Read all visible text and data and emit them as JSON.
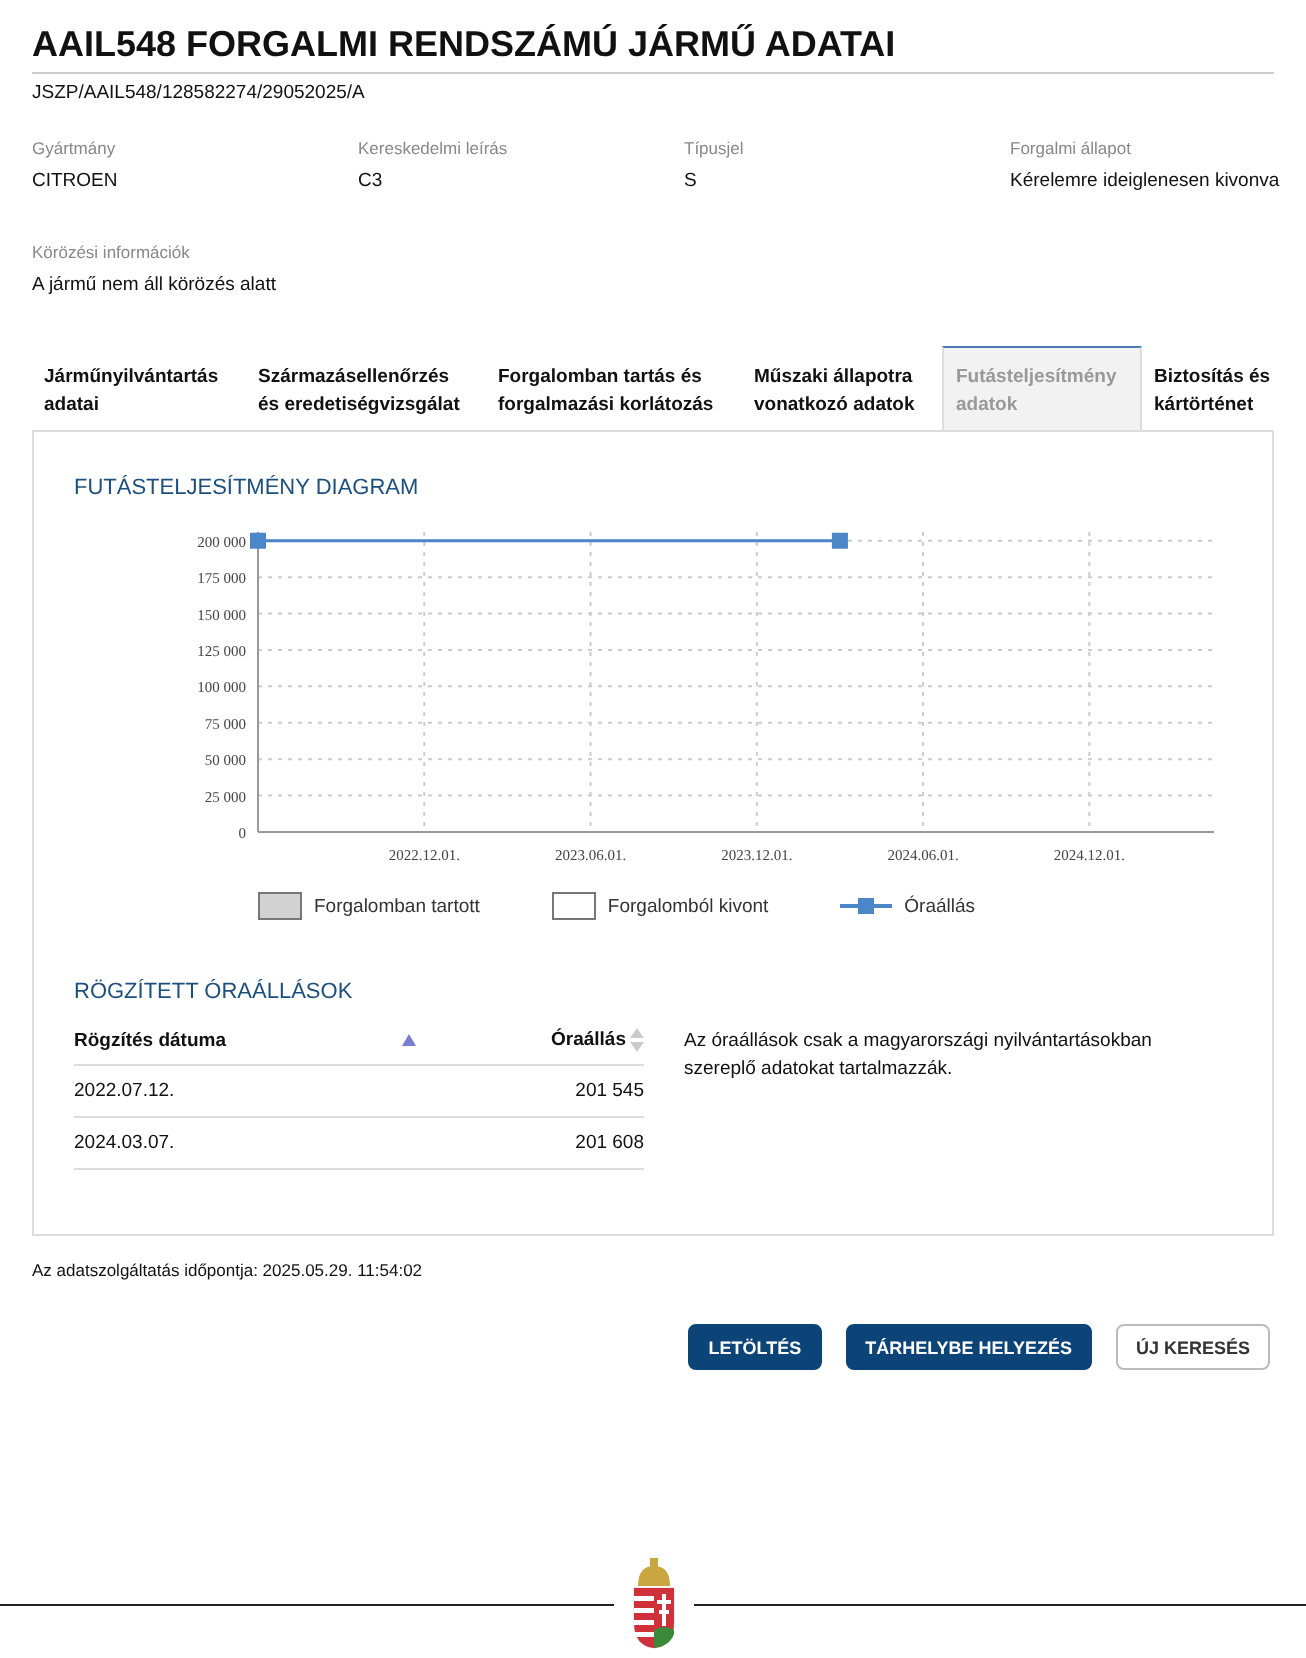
{
  "title": "AAIL548 FORGALMI RENDSZÁMÚ JÁRMŰ ADATAI",
  "reference": "JSZP/AAIL548/128582274/29052025/A",
  "fields": [
    {
      "label": "Gyártmány",
      "value": "CITROEN"
    },
    {
      "label": "Kereskedelmi leírás",
      "value": "C3"
    },
    {
      "label": "Típusjel",
      "value": "S"
    },
    {
      "label": "Forgalmi állapot",
      "value": "Kérelemre ideiglenesen kivonva"
    }
  ],
  "wanted": {
    "label": "Körözési információk",
    "value": "A jármű nem áll körözés alatt"
  },
  "tabs": [
    {
      "label": "Járműnyilvántartás adatai",
      "selected": false
    },
    {
      "label": "Származásellenőrzés és eredetiségvizsgálat",
      "selected": false
    },
    {
      "label": "Forgalomban tartás és forgalmazási korlátozás",
      "selected": false
    },
    {
      "label": "Műszaki állapotra vonatkozó adatok",
      "selected": false
    },
    {
      "label": "Futásteljesítmény adatok",
      "selected": true
    },
    {
      "label": "Biztosítás és kártörténet",
      "selected": false
    }
  ],
  "diagram": {
    "heading": "FUTÁSTELJESÍTMÉNY DIAGRAM",
    "chart_data": {
      "type": "line",
      "grid": true,
      "categories": [
        null,
        null,
        "2022.12.01.",
        null,
        "2023.06.01.",
        null,
        "2023.12.01.",
        null,
        "2024.06.01.",
        null,
        "2024.12.01.",
        null
      ],
      "series": [
        {
          "name": "Óraállás",
          "color": "#4a86c8",
          "marker": "square",
          "values": [
            200000,
            null,
            null,
            null,
            null,
            null,
            null,
            200000,
            null,
            null,
            null,
            null
          ]
        }
      ],
      "ylim": [
        0,
        206000
      ],
      "yticks": [
        {
          "value": 0,
          "label": "0"
        },
        {
          "value": 25000,
          "label": "25 000"
        },
        {
          "value": 50000,
          "label": "50 000"
        },
        {
          "value": 75000,
          "label": "75 000"
        },
        {
          "value": 100000,
          "label": "100 000"
        },
        {
          "value": 125000,
          "label": "125 000"
        },
        {
          "value": 150000,
          "label": "150 000"
        },
        {
          "value": 175000,
          "label": "175 000"
        },
        {
          "value": 200000,
          "label": "200 000"
        }
      ]
    },
    "legend": [
      {
        "kind": "box",
        "label": "Forgalomban tartott",
        "color": "#d3d3d3"
      },
      {
        "kind": "box",
        "label": "Forgalomból kivont",
        "color": "#ffffff"
      }
    ]
  },
  "readings": {
    "heading": "RÖGZÍTETT ÓRAÁLLÁSOK",
    "columns": [
      "Rögzítés dátuma",
      "Óraállás"
    ],
    "rows": [
      [
        "2022.07.12.",
        "201 545"
      ],
      [
        "2024.03.07.",
        "201 608"
      ]
    ],
    "note": "Az óraállások csak a magyarországi nyilvántartásokban szereplő adatokat tartalmazzák."
  },
  "timestamp": "Az adatszolgáltatás időpontja: 2025.05.29. 11:54:02",
  "buttons": [
    {
      "label": "LETÖLTÉS",
      "kind": "primary"
    },
    {
      "label": "TÁRHELYBE HELYEZÉS",
      "kind": "primary"
    },
    {
      "label": "ÚJ KERESÉS",
      "kind": "secondary"
    }
  ]
}
